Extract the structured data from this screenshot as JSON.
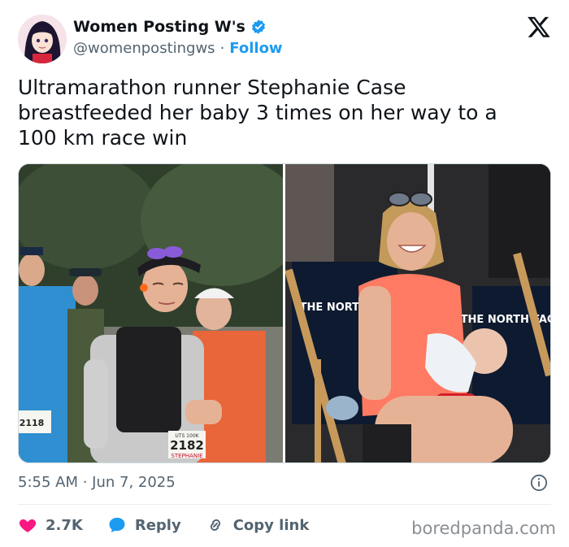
{
  "author": {
    "display_name": "Women Posting W's",
    "handle": "@womenpostingws",
    "separator": "·",
    "follow_label": "Follow"
  },
  "tweet": {
    "text": "Ultramarathon runner Stephanie Case\nbreastfeeded her baby 3 times on her way to a\n100 km race win",
    "timestamp": "5:55 AM · Jun 7, 2025"
  },
  "media": {
    "left_bib": "2182",
    "left_bib_name": "STEPHANIE",
    "left_bib_event": "UTS 100K",
    "left_other_bib": "2118",
    "right_brand_text": "THE NORTH FACE"
  },
  "actions": {
    "like_count": "2.7K",
    "reply_label": "Reply",
    "copy_link_label": "Copy link"
  },
  "watermark": "boredpanda.com",
  "colors": {
    "accent": "#1d9bf0",
    "like": "#f91880",
    "text": "#0f1419",
    "muted": "#536471"
  },
  "icons": {
    "verified": "verified-badge-icon",
    "x_logo": "x-logo-icon",
    "info": "info-icon",
    "like": "heart-icon",
    "reply": "reply-bubble-icon",
    "copy_link": "link-icon"
  }
}
